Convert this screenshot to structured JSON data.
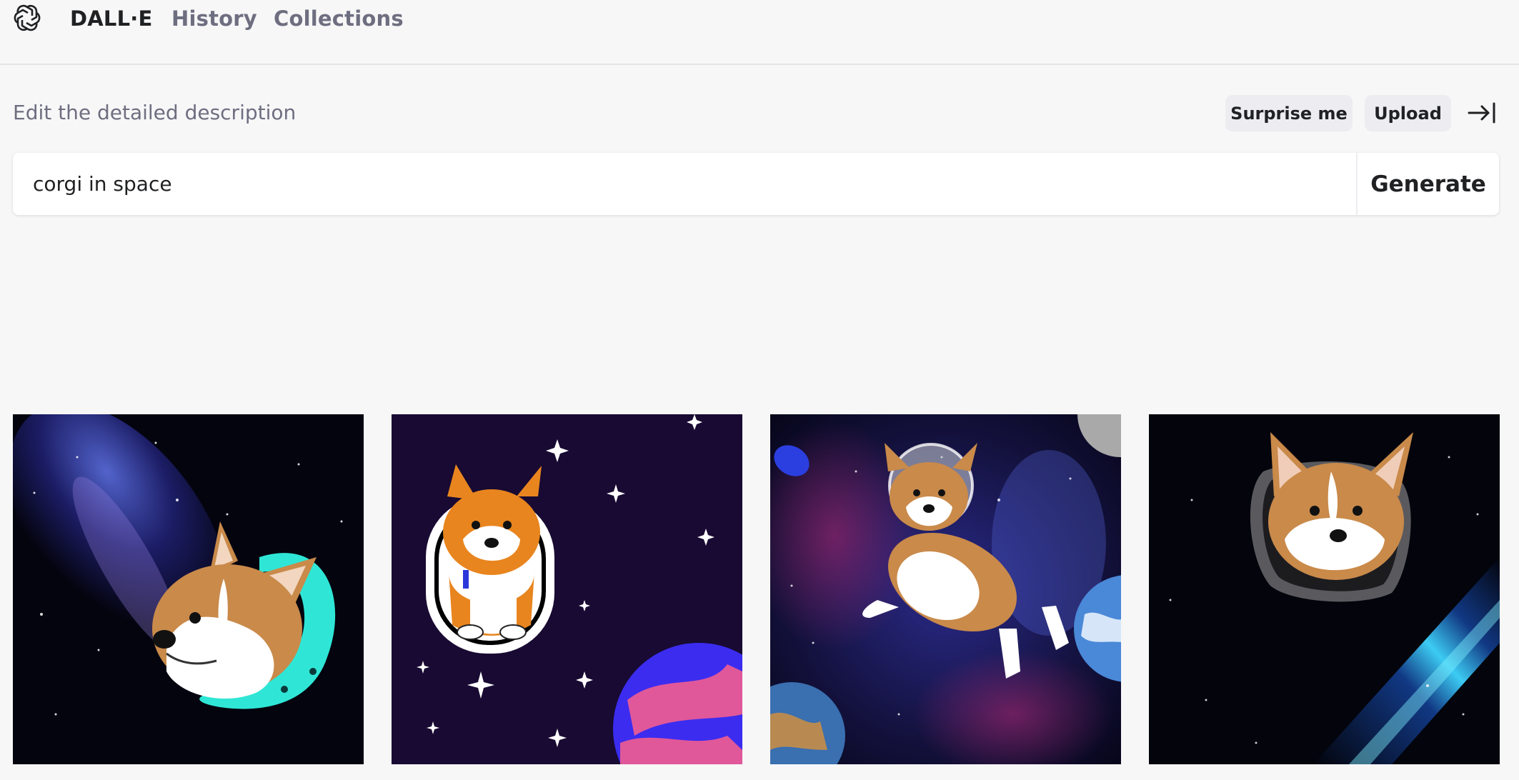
{
  "nav": {
    "logo_icon": "openai-logo-icon",
    "brand": "DALL·E",
    "history": "History",
    "collections": "Collections"
  },
  "prompt": {
    "label": "Edit the detailed description",
    "surprise_label": "Surprise me",
    "upload_label": "Upload",
    "collapse_icon": "collapse-panel-icon",
    "value": "corgi in space",
    "generate_label": "Generate"
  },
  "results": [
    {
      "subject": "corgi head in a teal space helmet against a galaxy"
    },
    {
      "subject": "cartoon corgi astronaut with stars and a planet"
    },
    {
      "subject": "corgi astronaut floating in a nebula near planets"
    },
    {
      "subject": "corgi head in a grey helmet beside a galaxy"
    }
  ],
  "colors": {
    "background": "#f7f7f8",
    "text": "#202123",
    "muted": "#6e6e80",
    "pill": "#ececf1"
  }
}
